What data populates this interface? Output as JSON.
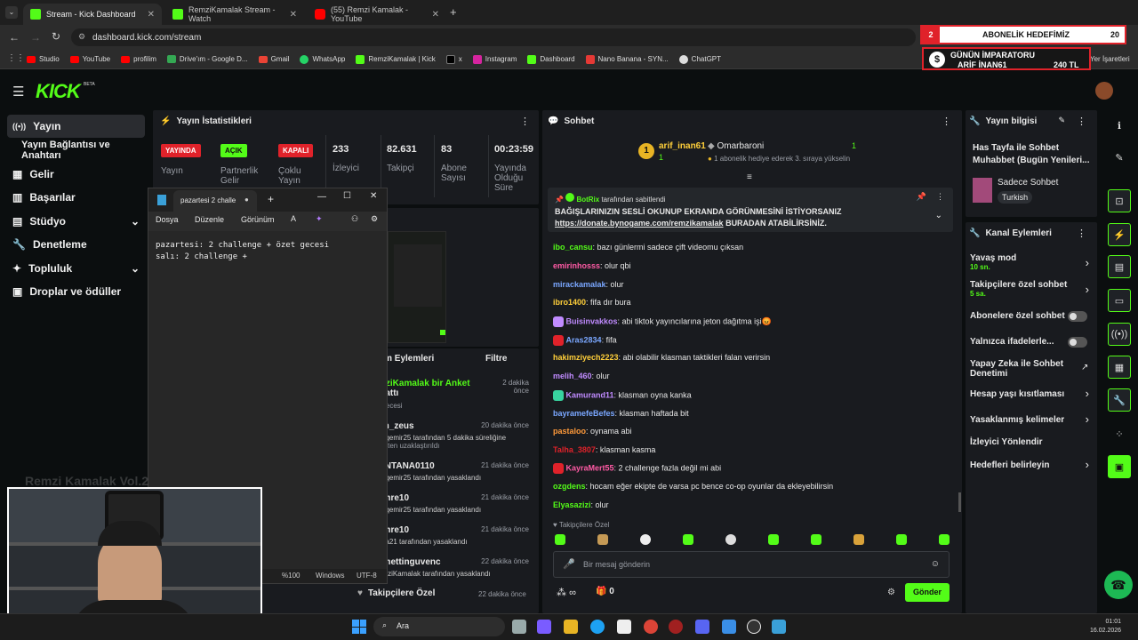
{
  "browser": {
    "tabs": [
      {
        "label": "Stream - Kick Dashboard",
        "color": "#53fc18"
      },
      {
        "label": "RemziKamalak Stream - Watch",
        "color": "#53fc18"
      },
      {
        "label": "(55) Remzi Kamalak - YouTube",
        "color": "#ff0000"
      }
    ],
    "url": "dashboard.kick.com/stream",
    "bookmarks": [
      "Studio",
      "YouTube",
      "profilim",
      "Drive'ım - Google D...",
      "Gmail",
      "WhatsApp",
      "RemziKamalak | Kick",
      "x",
      "Instagram",
      "Dashboard",
      "Nano Banana - SYN...",
      "ChatGPT"
    ],
    "bookmarks_right": "Yer İşaretleri",
    "new_tab": "+"
  },
  "overlay": {
    "sub_goal_num": "2",
    "sub_goal_label": "ABONELİK HEDEFİMİZ",
    "sub_goal_target": "20",
    "emperor_title": "GÜNÜN İMPARATORU",
    "emperor_name": "ARİF İNAN61",
    "emperor_amount": "240 TL",
    "stream_title_overlay": "Remzi Kamalak Vol.2"
  },
  "kick": {
    "logo": "KICK",
    "logo_beta": "BETA",
    "nav": [
      {
        "label": "Yayın",
        "icon": "broadcast-icon"
      },
      {
        "label": "Yayın Bağlantısı ve Anahtarı",
        "icon": ""
      },
      {
        "label": "Gelir",
        "icon": "revenue-icon"
      },
      {
        "label": "Başarılar",
        "icon": "trophy-icon"
      },
      {
        "label": "Stüdyo",
        "icon": "studio-icon"
      },
      {
        "label": "Denetleme",
        "icon": "wrench-icon"
      },
      {
        "label": "Topluluk",
        "icon": "community-icon"
      },
      {
        "label": "Droplar ve ödüller",
        "icon": "drops-icon"
      }
    ],
    "stats": {
      "title": "Yayın İstatistikleri",
      "badges": [
        {
          "badge": "YAYINDA",
          "label": "Yayın",
          "color": "#e0222a"
        },
        {
          "badge": "AÇIK",
          "label": "Partnerlik Gelir",
          "color": "#53fc18"
        },
        {
          "badge": "KAPALI",
          "label": "Çoklu Yayın",
          "color": "#e0222a"
        }
      ],
      "numbers": [
        {
          "value": "233",
          "label": "İzleyici"
        },
        {
          "value": "82.631",
          "label": "Takipçi"
        },
        {
          "value": "83",
          "label": "Abone Sayısı"
        },
        {
          "value": "00:23:59",
          "label": "Yayında Olduğu Süre"
        }
      ]
    },
    "activity": {
      "title": "tim Eylemleri",
      "filter": "Filtre",
      "items": [
        {
          "title": "mziKamalak bir Anket",
          "title2": "şlattı",
          "sub": "t gecesi",
          "time": "2 dakika önce"
        },
        {
          "title": "rm_zeus",
          "sub": "nzqemir25 tarafından 5 dakika süreliğine",
          "sub2": "betten uzaklaştırıldı",
          "time": "20 dakika önce"
        },
        {
          "title": "ONTANA0110",
          "sub": "nzqemir25 tarafından yasaklandı",
          "time": "21 dakika önce"
        },
        {
          "title": "emre10",
          "sub": "nzqemir25 tarafından yasaklandı",
          "time": "21 dakika önce"
        },
        {
          "title": "emre10",
          "sub": "kira21 tarafından yasaklandı",
          "time": "21 dakika önce"
        },
        {
          "title": "amettinguvenc",
          "sub": "emziKamalak tarafından yasaklandı",
          "time": "22 dakika önce"
        }
      ],
      "footer_label": "Takipçilere Özel",
      "footer_time": "22 dakika önce"
    },
    "chat": {
      "title": "Sohbet",
      "top_gifter": {
        "rank": "1",
        "name": "arif_inan61",
        "count": "1",
        "name2": "Omarbaroni",
        "count2": "1",
        "promo": "1 abonelik hediye ederek 3. sıraya yükselin"
      },
      "pinned_by": "BotRix",
      "pinned_suffix": "tarafından sabitlendi",
      "pinned_text": "BAĞIŞLARINIZIN SESLİ OKUNUP EKRANDA GÖRÜNMESİNİ İSTİYORSANIZ",
      "pinned_link": "https://donate.bynogame.com/remzikamalak",
      "pinned_tail": " BURADAN ATABİLİRSİNİZ.",
      "messages": [
        {
          "user": "ibo_cansu",
          "color": "#53fc18",
          "text": ": bazı günlermi sadece çift videomu çıksan"
        },
        {
          "user": "emirinhosss",
          "color": "#ff5aa5",
          "text": ": olur qbi"
        },
        {
          "user": "mirackamalak",
          "color": "#7aa7ff",
          "text": ": olur"
        },
        {
          "user": "ibro1400",
          "color": "#ffcf3a",
          "text": ": fifa dır bura"
        },
        {
          "user": "Buisinvakkos",
          "color": "#c08bff",
          "text": ": abi tiktok yayıncılarına jeton dağıtma işi😡"
        },
        {
          "user": "Aras2834",
          "color": "#7aa7ff",
          "text": ": fifa"
        },
        {
          "user": "hakimziyech2223",
          "color": "#ffcf3a",
          "text": ": abi olabilir klasman taktikleri falan verirsin"
        },
        {
          "user": "melih_460",
          "color": "#c08bff",
          "text": ": olur"
        },
        {
          "user": "Kamurand11",
          "color": "#c08bff",
          "text": ": klasman oyna kanka"
        },
        {
          "user": "bayramefeBefes",
          "color": "#7aa7ff",
          "text": ": klasman haftada bit"
        },
        {
          "user": "pastaloo",
          "color": "#ff9a3a",
          "text": ": oynama abi"
        },
        {
          "user": "Talha_3807",
          "color": "#e0222a",
          "text": ": klasman kasma"
        },
        {
          "user": "KayraMert55",
          "color": "#ff5aa5",
          "text": ": 2 challenge fazla değil mi abi"
        },
        {
          "user": "ozgdens",
          "color": "#53fc18",
          "text": ": hocam eğer ekipte de varsa pc bence co-op oyunlar da ekleyebilirsin"
        },
        {
          "user": "Elyasazizi",
          "color": "#53fc18",
          "text": ": olur"
        }
      ],
      "followers_only": "Takipçilere Özel",
      "input_placeholder": "Bir mesaj gönderin",
      "points": "0",
      "infinite": "∞",
      "send": "Gönder"
    },
    "stream_info": {
      "title": "Yayın bilgisi",
      "stream_title": "Has Tayfa ile Sohbet Muhabbet (Bugün Yenileri...",
      "category": "Sadece Sohbet",
      "language": "Turkish"
    },
    "channel_actions": {
      "title": "Kanal Eylemleri",
      "items": [
        {
          "label": "Yavaş mod",
          "sub": "10 sn.",
          "control": "chevron"
        },
        {
          "label": "Takipçilere özel sohbet",
          "sub": "5 sa.",
          "control": "chevron"
        },
        {
          "label": "Abonelere özel sohbet",
          "sub": "",
          "control": "toggle"
        },
        {
          "label": "Yalnızca ifadelerle...",
          "sub": "",
          "control": "toggle"
        },
        {
          "label": "Yapay Zeka ile Sohbet Denetimi",
          "sub": "",
          "control": "external"
        },
        {
          "label": "Hesap yaşı kısıtlaması",
          "sub": "",
          "control": "chevron"
        },
        {
          "label": "Yasaklanmış kelimeler",
          "sub": "",
          "control": "chevron"
        },
        {
          "label": "İzleyici Yönlendir",
          "sub": "",
          "control": "none"
        },
        {
          "label": "Hedefleri belirleyin",
          "sub": "",
          "control": "chevron"
        }
      ]
    }
  },
  "notepad": {
    "tab_title": "pazartesi 2 challe",
    "menu": [
      "Dosya",
      "Düzenle",
      "Görünüm"
    ],
    "lines": [
      "pazartesi: 2 challenge + özet gecesi",
      "salı: 2 challenge +"
    ],
    "status": [
      "%100",
      "Windows",
      "UTF-8"
    ]
  },
  "taskbar": {
    "search": "Ara",
    "time": "01:01",
    "date": "16.02.2026"
  }
}
